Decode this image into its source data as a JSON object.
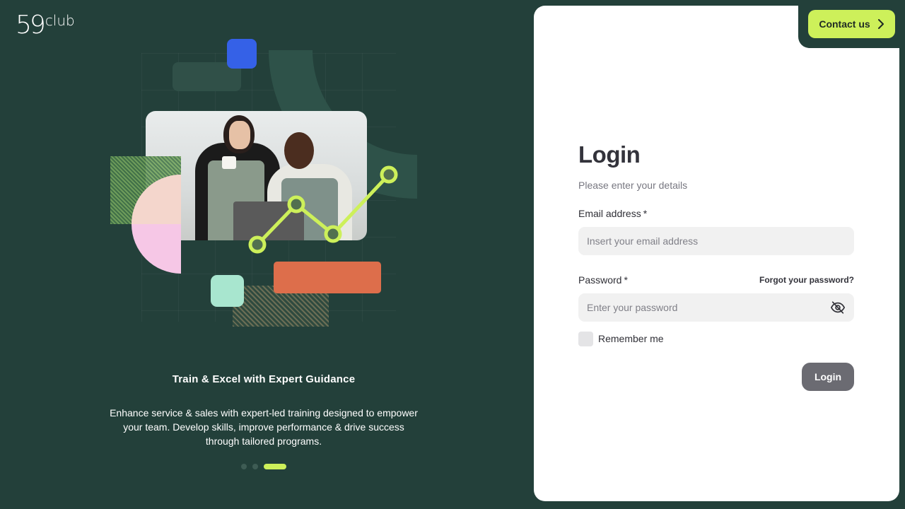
{
  "brand": {
    "logo_number": "59",
    "logo_word": "club"
  },
  "header": {
    "contact_label": "Contact us"
  },
  "carousel": {
    "title": "Train & Excel with Expert Guidance",
    "description": "Enhance service & sales with expert-led training designed to empower your team. Develop skills, improve performance & drive success through tailored programs.",
    "slide_count": 3,
    "active_slide": 3
  },
  "login": {
    "title": "Login",
    "subtitle": "Please enter your details",
    "email_label": "Email address",
    "email_required": "*",
    "email_placeholder": "Insert your email address",
    "password_label": "Password",
    "password_required": "*",
    "password_placeholder": "Enter your password",
    "forgot_label": "Forgot your password?",
    "remember_label": "Remember me",
    "submit_label": "Login"
  },
  "colors": {
    "background": "#23403a",
    "accent": "#cdf05a",
    "button_disabled": "#6b6b72"
  },
  "icons": {
    "contact_chevron": "chevron-right-icon",
    "password_toggle": "eye-off-icon"
  }
}
